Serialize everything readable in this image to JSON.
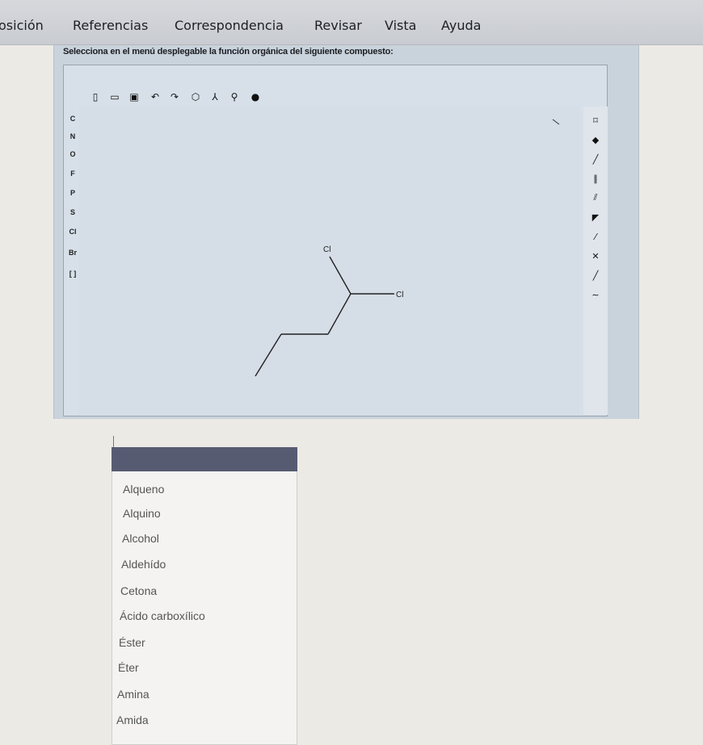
{
  "ribbon": {
    "items": [
      "osición",
      "Referencias",
      "Correspondencia",
      "Revisar",
      "Vista",
      "Ayuda"
    ]
  },
  "question": {
    "prompt": "Selecciona en el menú desplegable la función orgánica del siguiente compuesto:"
  },
  "editor": {
    "toolbar_icons": [
      "new-icon",
      "open-icon",
      "save-icon",
      "undo-icon",
      "redo-icon",
      "ring-icon",
      "structure-icon",
      "zoom-icon",
      "settings-icon"
    ],
    "atoms": [
      "C",
      "N",
      "O",
      "F",
      "P",
      "S",
      "Cl",
      "Br",
      "[ ]"
    ],
    "molecule_labels": [
      "Cl",
      "Cl"
    ],
    "right_tools": [
      "select-icon",
      "eraser-icon",
      "single-bond-icon",
      "double-bond-icon",
      "triple-bond-icon",
      "wedge-bond-icon",
      "hash-bond-icon",
      "cross-bond-icon",
      "plain-bond-icon",
      "chain-icon"
    ]
  },
  "dropdown": {
    "selected": "",
    "options": [
      "Alqueno",
      "Alquino",
      "Alcohol",
      "Aldehído",
      "Cetona",
      "Ácido carboxílico",
      "Éster",
      "Éter",
      "Amina",
      "Amida"
    ]
  }
}
